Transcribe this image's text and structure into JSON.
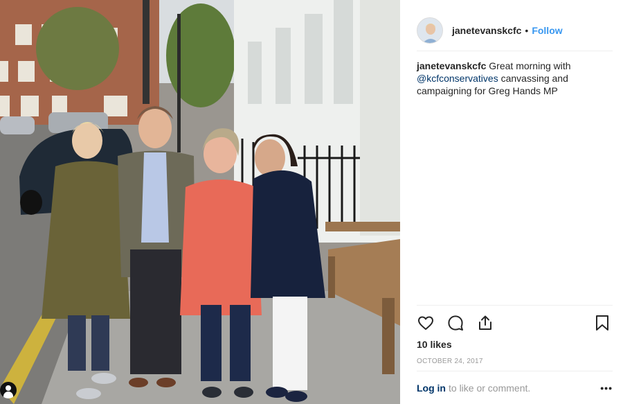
{
  "post": {
    "username": "janetevanskcfc",
    "separator": "•",
    "follow_label": "Follow",
    "caption": {
      "user": "janetevanskcfc",
      "text_before": "Great morning with",
      "mention": "@kcfconservatives",
      "text_after": "canvassing and campaigning for Greg Hands MP"
    },
    "likes": "10 likes",
    "date": "OCTOBER 24, 2017",
    "comment_prompt": {
      "login_label": "Log in",
      "rest": "to like or comment."
    },
    "more_label": "•••"
  },
  "icons": {
    "like": "heart-icon",
    "comment": "comment-icon",
    "share": "share-icon",
    "save": "bookmark-icon",
    "profile": "user-icon"
  },
  "colors": {
    "link_blue": "#3897f0",
    "mention_blue": "#003569",
    "muted_gray": "#999999",
    "divider": "#efefef"
  }
}
